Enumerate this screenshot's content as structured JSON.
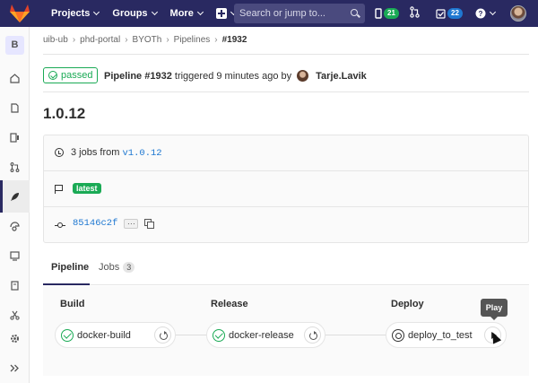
{
  "topbar": {
    "nav": {
      "projects": "Projects",
      "groups": "Groups",
      "more": "More"
    },
    "search_placeholder": "Search or jump to...",
    "counts": {
      "issues": "21",
      "todos": "22"
    },
    "colors": {
      "bg": "#292961",
      "issues_badge": "#1aaa55",
      "todos_badge": "#1f78d1"
    }
  },
  "sidebar": {
    "project_initial": "B"
  },
  "breadcrumb": [
    "uib-ub",
    "phd-portal",
    "BYOTh",
    "Pipelines",
    "#1932"
  ],
  "pipeline": {
    "status": "passed",
    "label": "Pipeline #1932",
    "triggered": "triggered 9 minutes ago by",
    "author": "Tarje.Lavik",
    "version_title": "1.0.12"
  },
  "info": {
    "jobs_prefix": "3 jobs from",
    "ref": "v1.0.12",
    "latest_tag": "latest",
    "commit_sha": "85146c2f",
    "ellipsis": "···"
  },
  "tabs": {
    "pipeline": "Pipeline",
    "jobs": "Jobs",
    "jobs_count": "3"
  },
  "graph": {
    "stages": [
      {
        "name": "Build",
        "job": "docker-build",
        "status": "passed"
      },
      {
        "name": "Release",
        "job": "docker-release",
        "status": "passed"
      },
      {
        "name": "Deploy",
        "job": "deploy_to_test",
        "status": "manual"
      }
    ],
    "tooltip": "Play"
  }
}
